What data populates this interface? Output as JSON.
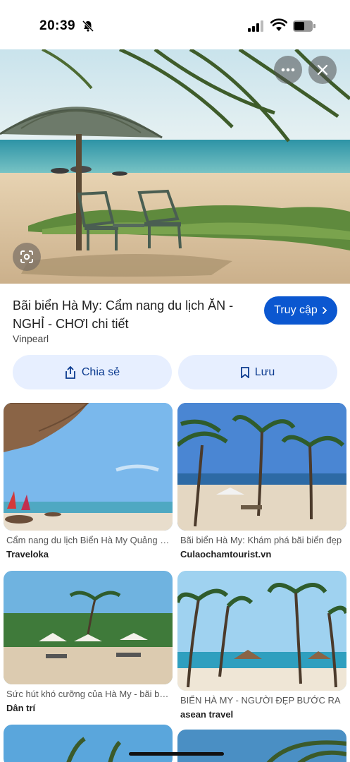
{
  "status_bar": {
    "time": "20:39"
  },
  "result": {
    "title": "Bãi biển Hà My: Cẩm nang du lịch ĂN - NGHỈ - CHƠI chi tiết",
    "source": "Vinpearl",
    "visit_label": "Truy cập",
    "share_label": "Chia sẻ",
    "save_label": "Lưu"
  },
  "related": [
    {
      "caption": "Cẩm nang du lịch Biển Hà My Quảng Nam",
      "source": "Traveloka"
    },
    {
      "caption": "Bãi biển Hà My: Khám phá bãi biển đẹp",
      "source": "Culaochamtourist.vn"
    },
    {
      "caption": "Sức hút khó cưỡng của Hà My - bãi biển",
      "source": "Dân trí"
    },
    {
      "caption": "BIỂN HÀ MY - NGƯỜI ĐẸP BƯỚC RA",
      "source": "asean travel"
    }
  ],
  "colors": {
    "accent": "#0b57d0",
    "tonal_button": "#e7efff"
  }
}
